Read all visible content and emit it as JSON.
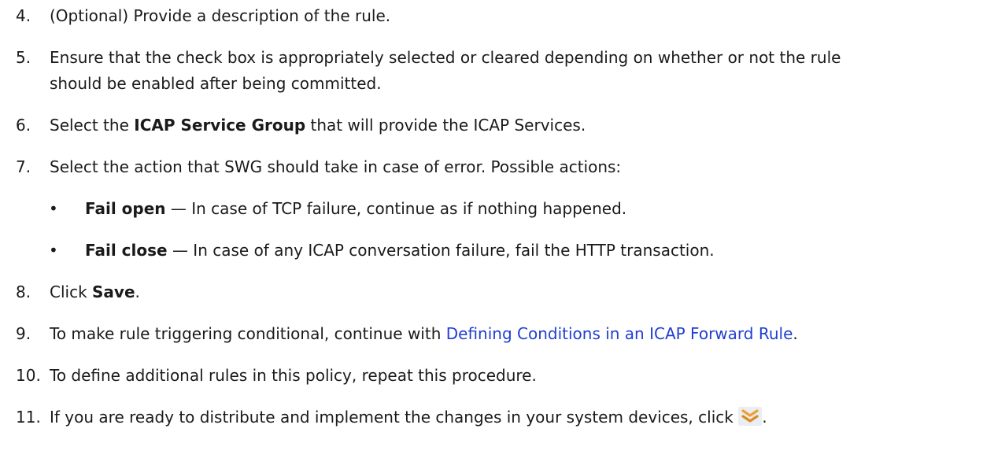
{
  "steps": [
    {
      "num": "4.",
      "text": "(Optional) Provide a description of the rule."
    },
    {
      "num": "5.",
      "line1": "Ensure that the check box is appropriately selected or cleared depending on whether or not the rule",
      "line2": "should be enabled after being committed."
    },
    {
      "num": "6.",
      "pre": "Select the ",
      "bold": "ICAP Service Group",
      "post": " that will provide the ICAP Services."
    },
    {
      "num": "7.",
      "text": "Select the action that SWG should take in case of error. Possible actions:"
    },
    {
      "num": "8.",
      "pre": "Click ",
      "bold": "Save",
      "post": "."
    },
    {
      "num": "9.",
      "pre": "To make rule triggering conditional, continue with ",
      "link": "Defining Conditions in an ICAP Forward Rule",
      "post": "."
    },
    {
      "num": "10.",
      "text": "To define additional rules in this policy, repeat this procedure."
    },
    {
      "num": "11.",
      "pre": "If you are ready to distribute and implement the changes in your system devices, click ",
      "post": "."
    }
  ],
  "bullets": [
    {
      "dot": "•",
      "bold": "Fail open",
      "text": " — In case of TCP failure, continue as if nothing happened."
    },
    {
      "dot": "•",
      "bold": "Fail close",
      "text": " — In case of any ICAP conversation failure, fail the HTTP transaction."
    }
  ],
  "icons": {
    "deploy": "deploy-changes-icon",
    "deploy_color": "#f0a030"
  }
}
